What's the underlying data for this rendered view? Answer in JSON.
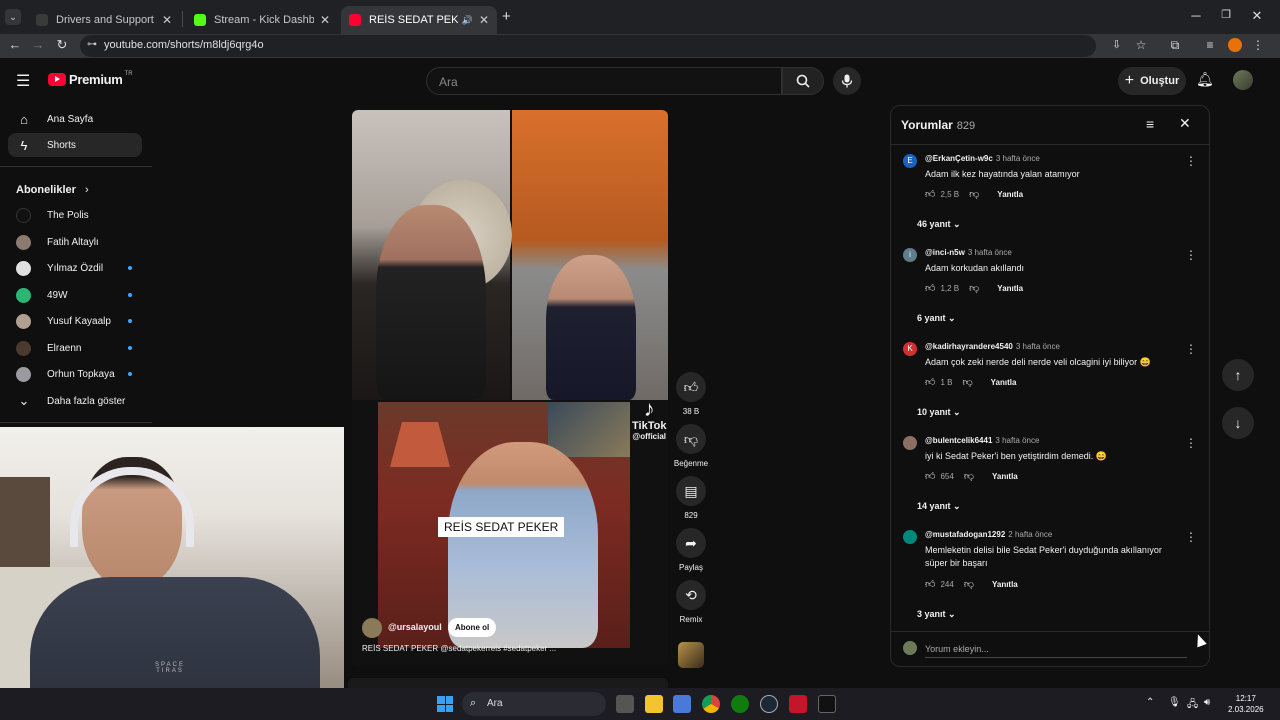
{
  "browser": {
    "tabs": [
      {
        "title": "Drivers and Support for Proces",
        "favicon_color": "#3a3a3a"
      },
      {
        "title": "Stream - Kick Dashboard",
        "favicon_color": "#53fc18"
      },
      {
        "title": "REİS SEDAT PEKER @sedatp",
        "favicon_color": "#ff0033"
      }
    ],
    "url": "youtube.com/shorts/m8ldj6qrg4o"
  },
  "youtube": {
    "logo_text": "Premium",
    "logo_region": "TR",
    "search_placeholder": "Ara",
    "create_label": "Oluştur"
  },
  "sidebar": {
    "home": "Ana Sayfa",
    "shorts": "Shorts",
    "subscriptions_header": "Abonelikler",
    "channels": [
      {
        "name": "The Polis",
        "color": "#111111",
        "new": false
      },
      {
        "name": "Fatih Altaylı",
        "color": "#8a7a70",
        "new": false
      },
      {
        "name": "Yılmaz Özdil",
        "color": "#e0e0e0",
        "new": true
      },
      {
        "name": "49W",
        "color": "#2bb673",
        "new": true
      },
      {
        "name": "Yusuf Kayaalp",
        "color": "#b0a090",
        "new": true
      },
      {
        "name": "Elraenn",
        "color": "#4a3a30",
        "new": true
      },
      {
        "name": "Orhun Topkaya",
        "color": "#9a9aa0",
        "new": true
      }
    ],
    "show_more": "Daha fazla göster"
  },
  "short": {
    "tiktok_label": "TikTok",
    "tiktok_handle": "@official",
    "caption_overlay": "REİS SEDAT PEKER",
    "channel_handle": "@ursalayoul",
    "subscribe_label": "Abone ol",
    "title": "REİS SEDAT PEKER @sedatpekerreis #sedatpeker ...",
    "actions": {
      "like_count": "38 B",
      "dislike_label": "Beğenme",
      "comment_count": "829",
      "share_label": "Paylaş",
      "remix_label": "Remix"
    }
  },
  "comments": {
    "header": "Yorumlar",
    "count": "829",
    "items": [
      {
        "avatar_letter": "E",
        "avatar_color": "#1565c0",
        "user": "@ErkanÇetin-w9c",
        "time": "3 hafta önce",
        "text": "Adam ilk kez hayatında yalan atamıyor",
        "likes": "2,5 B",
        "reply": "Yanıtla",
        "replies": "46 yanıt"
      },
      {
        "avatar_letter": "i",
        "avatar_color": "#607d8b",
        "user": "@inci-n5w",
        "time": "3 hafta önce",
        "text": "Adam korkudan akıllandı",
        "likes": "1,2 B",
        "reply": "Yanıtla",
        "replies": "6 yanıt"
      },
      {
        "avatar_letter": "K",
        "avatar_color": "#d32f2f",
        "user": "@kadirhayrandere4540",
        "time": "3 hafta önce",
        "text": "Adam çok zeki nerde deli nerde veli olcagini iyi biliyor 😄",
        "likes": "1 B",
        "reply": "Yanıtla",
        "replies": "10 yanıt"
      },
      {
        "avatar_letter": "",
        "avatar_color": "#8d6e63",
        "user": "@bulentcelik6441",
        "time": "3 hafta önce",
        "text": "iyi ki Sedat Peker'i ben yetiştirdim demedi. 😄",
        "likes": "654",
        "reply": "Yanıtla",
        "replies": "14 yanıt"
      },
      {
        "avatar_letter": "",
        "avatar_color": "#00897b",
        "user": "@mustafadogan1292",
        "time": "2 hafta önce",
        "text": "Memleketin delisi bile Sedat Peker'i duyduğunda akıllanıyor süper bir başarı",
        "likes": "244",
        "reply": "Yanıtla",
        "replies": "3 yanıt"
      }
    ],
    "input_placeholder": "Yorum ekleyin..."
  },
  "webcam": {
    "hoodie_text": "SPACE TIRAS"
  },
  "taskbar": {
    "search_label": "Ara",
    "time": "12:17",
    "date": "2.03.2026"
  }
}
